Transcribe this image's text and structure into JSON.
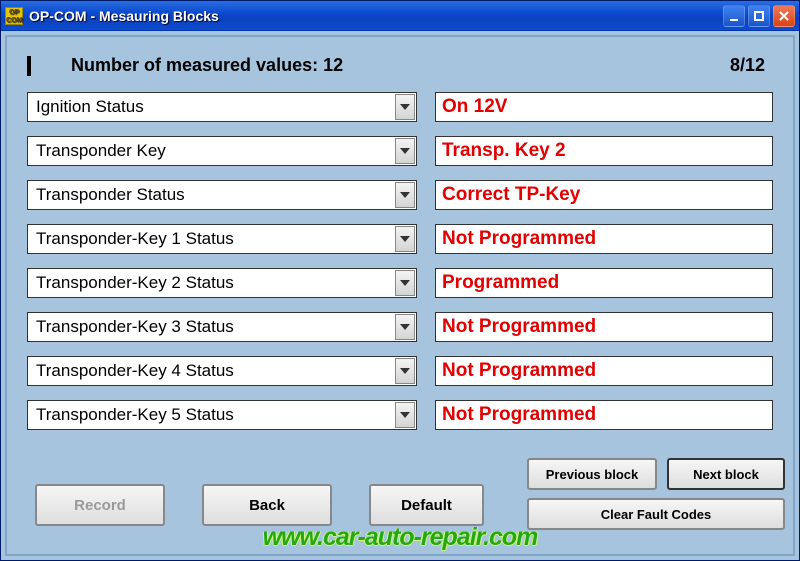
{
  "window": {
    "title": "OP-COM - Mesauring Blocks",
    "icon_text": "OP COM"
  },
  "header": {
    "measured_label": "Number of measured values: 12",
    "page_indicator": "8/12"
  },
  "rows": [
    {
      "label": "Ignition Status",
      "value": "On  12V"
    },
    {
      "label": "Transponder Key",
      "value": "Transp. Key 2"
    },
    {
      "label": "Transponder Status",
      "value": "Correct TP-Key"
    },
    {
      "label": "Transponder-Key 1 Status",
      "value": "Not Programmed"
    },
    {
      "label": "Transponder-Key 2 Status",
      "value": "Programmed"
    },
    {
      "label": "Transponder-Key 3 Status",
      "value": "Not Programmed"
    },
    {
      "label": "Transponder-Key 4 Status",
      "value": "Not Programmed"
    },
    {
      "label": "Transponder-Key 5 Status",
      "value": "Not Programmed"
    }
  ],
  "buttons": {
    "record": "Record",
    "back": "Back",
    "default": "Default",
    "previous_block": "Previous block",
    "next_block": "Next block",
    "clear_fault_codes": "Clear Fault Codes"
  },
  "watermark": "www.car-auto-repair.com"
}
